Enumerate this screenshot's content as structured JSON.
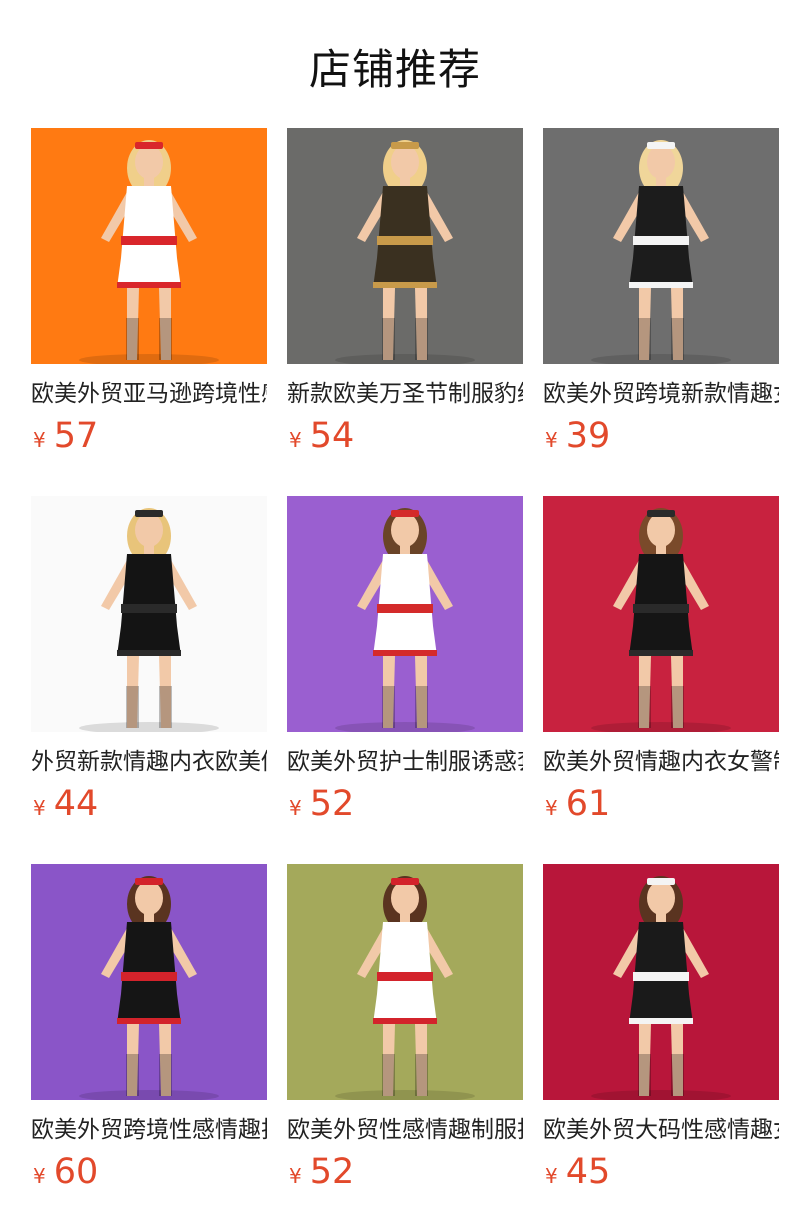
{
  "section": {
    "title": "店铺推荐"
  },
  "currency": "¥",
  "products": [
    {
      "name": "欧美外贸亚马逊跨境性感护士制服",
      "price": "57",
      "bg": "#ff7a12",
      "outfit": "#ffffff",
      "accent": "#d9262b",
      "hair": "#f0cf8a",
      "icon": "nurse-costume-photo"
    },
    {
      "name": "新款欧美万圣节制服豹纹连体衣",
      "price": "54",
      "bg": "#6b6b69",
      "outfit": "#3a3020",
      "accent": "#c89a4a",
      "hair": "#f0cf8a",
      "icon": "leopard-bodysuit-photo"
    },
    {
      "name": "欧美外贸跨境新款情趣女仆装",
      "price": "39",
      "bg": "#6e6e6e",
      "outfit": "#1c1c1c",
      "accent": "#f4f4f4",
      "hair": "#f0d69a",
      "icon": "maid-costume-photo"
    },
    {
      "name": "外贸新款情趣内衣欧美修女服",
      "price": "44",
      "bg": "#fafafa",
      "outfit": "#141414",
      "accent": "#2a2a2a",
      "hair": "#e8c47a",
      "icon": "nun-costume-photo"
    },
    {
      "name": "欧美外贸护士制服诱惑套装",
      "price": "52",
      "bg": "#9a5fd0",
      "outfit": "#ffffff",
      "accent": "#d42a2a",
      "hair": "#6a4428",
      "icon": "nurse-crop-top-photo"
    },
    {
      "name": "欧美外贸情趣内衣女警制服",
      "price": "61",
      "bg": "#c8223f",
      "outfit": "#151515",
      "accent": "#2a2a2a",
      "hair": "#7a4a2a",
      "icon": "police-costume-photo"
    },
    {
      "name": "欧美外贸跨境性感情趣护士装",
      "price": "60",
      "bg": "#8a55c8",
      "outfit": "#151515",
      "accent": "#d3232b",
      "hair": "#5a3420",
      "icon": "black-nurse-costume-photo"
    },
    {
      "name": "欧美外贸性感情趣制服护士装",
      "price": "52",
      "bg": "#a4a95b",
      "outfit": "#ffffff",
      "accent": "#d3232b",
      "hair": "#5a3420",
      "icon": "white-nurse-dress-photo"
    },
    {
      "name": "欧美外贸大码性感情趣女仆装",
      "price": "45",
      "bg": "#b8163a",
      "outfit": "#1a1a1a",
      "accent": "#f4f4f4",
      "hair": "#5a3420",
      "icon": "lace-maid-costume-photo"
    }
  ]
}
